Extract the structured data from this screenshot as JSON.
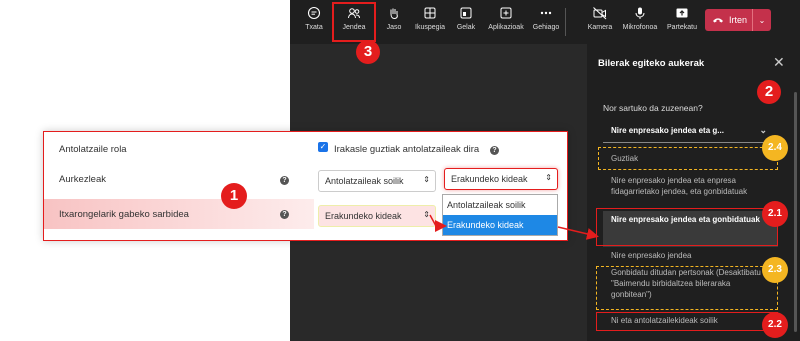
{
  "toolbar": {
    "items": [
      {
        "label": "Txata",
        "icon": "chat-icon"
      },
      {
        "label": "Jendea",
        "icon": "people-icon"
      },
      {
        "label": "Jaso",
        "icon": "raise-hand-icon"
      },
      {
        "label": "Ikuspegia",
        "icon": "view-icon"
      },
      {
        "label": "Gelak",
        "icon": "rooms-icon"
      },
      {
        "label": "Aplikazioak",
        "icon": "apps-icon"
      },
      {
        "label": "Gehiago",
        "icon": "more-icon"
      },
      {
        "label": "Kamera",
        "icon": "camera-off-icon"
      },
      {
        "label": "Mikrofonoa",
        "icon": "microphone-icon"
      },
      {
        "label": "Partekatu",
        "icon": "share-icon"
      }
    ],
    "leave_label": "Irten"
  },
  "panel": {
    "title": "Bilerak egiteko aukerak",
    "question": "Nor sartuko da zuzenean?",
    "selected": "Nire enpresako jendea eta g...",
    "options": [
      "Guztiak",
      "Nire enpresako jendea eta enpresa fidagarrietako jendea, eta gonbidatuak",
      "Nire enpresako jendea eta gonbidatuak",
      "Nire enpresako jendea",
      "Gonbidatu ditudan pertsonak (Desaktibatu \"Baimendu birbidaltzea bileraraka gonbitean\")",
      "Ni eta antolatzailekideak soilik"
    ]
  },
  "settings": {
    "row1_label": "Antolatzaile rola",
    "row1_checkbox": "Irakasle guztiak antolatzaileak dira",
    "row2_label": "Aurkezleak",
    "row2_select1": "Antolatzaileak soilik",
    "row2_select2": "Erakundeko kideak",
    "row3_label": "Itxarongelarik gabeko sarbidea",
    "row3_select": "Erakundeko kideak",
    "dropdown_options": [
      "Antolatzaileak soilik",
      "Erakundeko kideak"
    ],
    "help": "?"
  },
  "badges": {
    "b1": "1",
    "b2": "2",
    "b3": "3",
    "b24": "2.4",
    "b21": "2.1",
    "b23": "2.3",
    "b22": "2.2"
  },
  "colors": {
    "annotation_red": "#e41d1d",
    "annotation_yellow": "#f4b622",
    "leave_button": "#c4314b",
    "dropdown_highlight": "#1e88e5"
  }
}
